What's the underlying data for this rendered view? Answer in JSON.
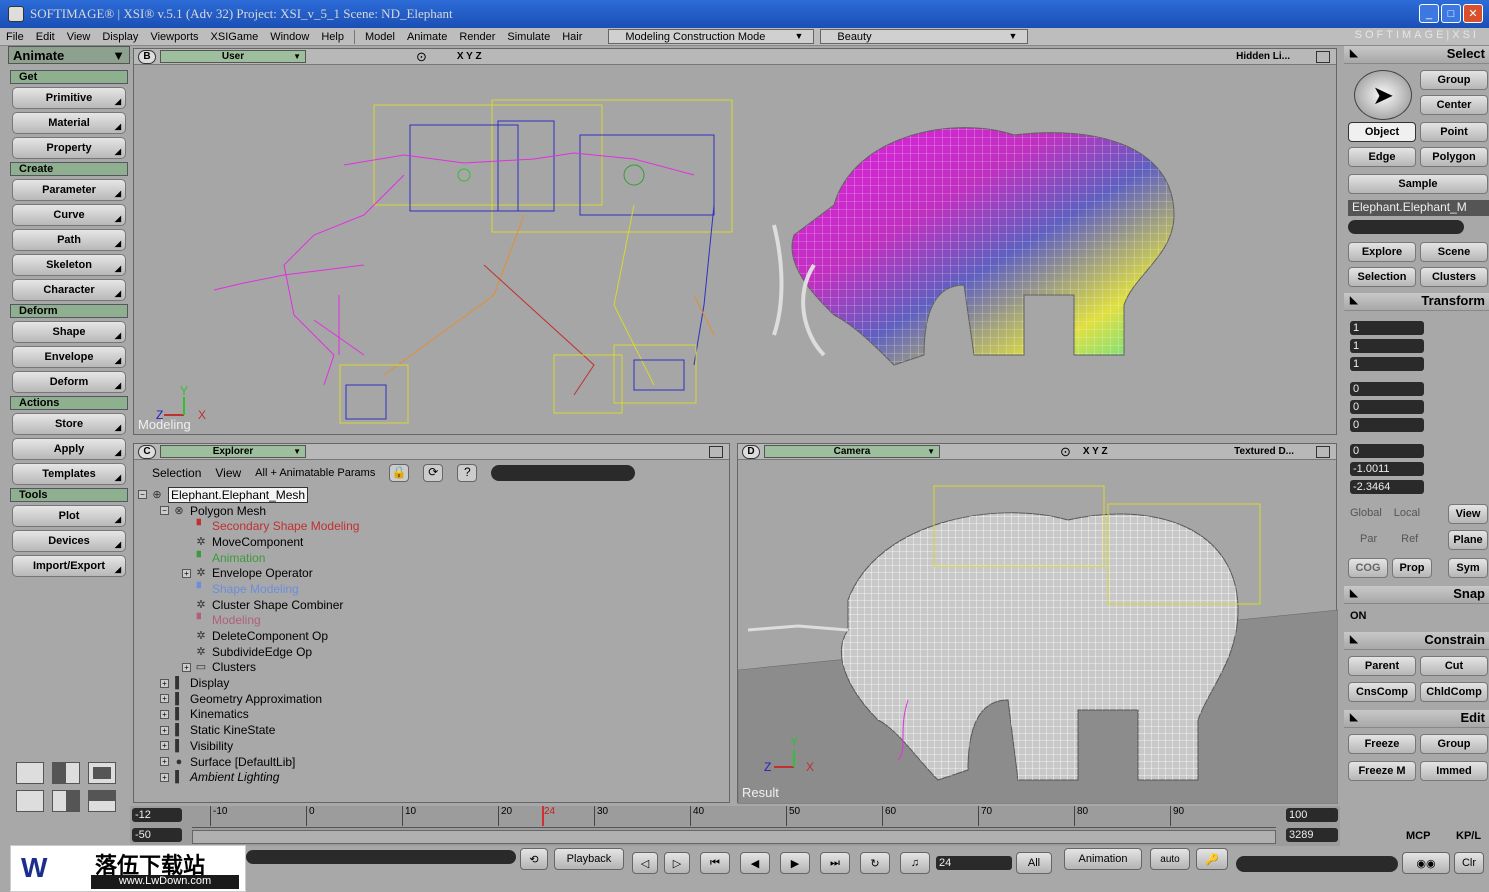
{
  "window": {
    "title": "SOFTIMAGE® | XSI® v.5.1 (Adv 32) Project: XSI_v_5_1     Scene: ND_Elephant",
    "brand": "SOFTIMAGE|XSI"
  },
  "menu": [
    "File",
    "Edit",
    "View",
    "Display",
    "Viewports",
    "XSIGame",
    "Window",
    "Help",
    "Model",
    "Animate",
    "Render",
    "Simulate",
    "Hair"
  ],
  "mode_dropdown": "Modeling Construction Mode",
  "pass_dropdown": "Beauty",
  "left_panel": {
    "mode": "Animate",
    "sections": [
      {
        "header": "Get",
        "buttons": [
          "Primitive",
          "Material",
          "Property"
        ]
      },
      {
        "header": "Create",
        "buttons": [
          "Parameter",
          "Curve",
          "Path",
          "Skeleton",
          "Character"
        ]
      },
      {
        "header": "Deform",
        "buttons": [
          "Shape",
          "Envelope",
          "Deform"
        ]
      },
      {
        "header": "Actions",
        "buttons": [
          "Store",
          "Apply",
          "Templates"
        ]
      },
      {
        "header": "Tools",
        "buttons": [
          "Plot",
          "Devices",
          "Import/Export"
        ]
      }
    ]
  },
  "viewport_b": {
    "letter": "B",
    "camera": "User",
    "axes": "X Y Z",
    "display": "Hidden Li...",
    "label": "Modeling"
  },
  "viewport_c": {
    "letter": "C",
    "camera": "Explorer",
    "toolbar": [
      "Selection",
      "View",
      "All + Animatable Params"
    ]
  },
  "viewport_d": {
    "letter": "D",
    "camera": "Camera",
    "axes": "X Y Z",
    "display": "Textured D...",
    "label": "Result"
  },
  "tree": [
    {
      "label": "Elephant.Elephant_Mesh",
      "level": 0,
      "exp": "⊟",
      "icon": "model",
      "color": "#000"
    },
    {
      "label": "Polygon Mesh",
      "level": 1,
      "exp": "⊟",
      "icon": "mesh",
      "color": "#000"
    },
    {
      "label": "Secondary Shape Modeling",
      "level": 2,
      "exp": "",
      "icon": "flag",
      "color": "#c03030"
    },
    {
      "label": "MoveComponent",
      "level": 2,
      "exp": "",
      "icon": "gear",
      "color": "#000"
    },
    {
      "label": "Animation",
      "level": 2,
      "exp": "",
      "icon": "flag",
      "color": "#3c9a3c"
    },
    {
      "label": "Envelope Operator",
      "level": 2,
      "exp": "⊞",
      "icon": "gear",
      "color": "#000"
    },
    {
      "label": "Shape Modeling",
      "level": 2,
      "exp": "",
      "icon": "flag",
      "color": "#6a8ee0"
    },
    {
      "label": "Cluster Shape Combiner",
      "level": 2,
      "exp": "",
      "icon": "gear",
      "color": "#000"
    },
    {
      "label": "Modeling",
      "level": 2,
      "exp": "",
      "icon": "flag",
      "color": "#b0607a"
    },
    {
      "label": "DeleteComponent Op",
      "level": 2,
      "exp": "",
      "icon": "gear",
      "color": "#000"
    },
    {
      "label": "SubdivideEdge Op",
      "level": 2,
      "exp": "",
      "icon": "gear",
      "color": "#000"
    },
    {
      "label": "Clusters",
      "level": 2,
      "exp": "⊞",
      "icon": "folder",
      "color": "#000"
    },
    {
      "label": "Display",
      "level": 1,
      "exp": "⊞",
      "icon": "prop",
      "color": "#000"
    },
    {
      "label": "Geometry Approximation",
      "level": 1,
      "exp": "⊞",
      "icon": "prop",
      "color": "#000"
    },
    {
      "label": "Kinematics",
      "level": 1,
      "exp": "⊞",
      "icon": "prop",
      "color": "#000"
    },
    {
      "label": "Static KineState",
      "level": 1,
      "exp": "⊞",
      "icon": "prop",
      "color": "#000"
    },
    {
      "label": "Visibility",
      "level": 1,
      "exp": "⊞",
      "icon": "prop",
      "color": "#000"
    },
    {
      "label": "Surface [DefaultLib]",
      "level": 1,
      "exp": "⊞",
      "icon": "sphere",
      "color": "#000"
    },
    {
      "label": "Ambient Lighting",
      "level": 1,
      "exp": "⊞",
      "icon": "prop",
      "color": "#000",
      "italic": true
    }
  ],
  "right_panel": {
    "select": "Select",
    "group": "Group",
    "center": "Center",
    "object": "Object",
    "point": "Point",
    "edge": "Edge",
    "polygon": "Polygon",
    "sample": "Sample",
    "selected_name": "Elephant.Elephant_M",
    "explore": "Explore",
    "scene": "Scene",
    "selection": "Selection",
    "clusters": "Clusters",
    "transform": "Transform",
    "scale": [
      "1",
      "1",
      "1"
    ],
    "rotation": [
      "0",
      "0",
      "0"
    ],
    "translation": [
      "0",
      "-1.0011",
      "-2.3464"
    ],
    "global": "Global",
    "local": "Local",
    "view": "View",
    "par": "Par",
    "ref": "Ref",
    "plane": "Plane",
    "cog": "COG",
    "prop": "Prop",
    "sym": "Sym",
    "snap": "Snap",
    "on": "ON",
    "constrain": "Constrain",
    "parent": "Parent",
    "cut": "Cut",
    "cnscomp": "CnsComp",
    "chldcomp": "ChldComp",
    "edit": "Edit",
    "freeze": "Freeze",
    "group2": "Group",
    "freezem": "Freeze M",
    "immed": "Immed",
    "mcp": "MCP",
    "kpl": "KP/L"
  },
  "timeline": {
    "start": "-12",
    "start2": "-50",
    "end": "100",
    "end2": "3289",
    "ticks": [
      "-10",
      "0",
      "10",
      "20",
      "30",
      "40",
      "50",
      "60",
      "70",
      "80",
      "90"
    ],
    "current": "24"
  },
  "playback": {
    "label": "Playback",
    "frame": "24",
    "all": "All",
    "animation": "Animation",
    "auto": "auto",
    "clr": "Clr"
  },
  "watermark": {
    "cn": "落伍下载站",
    "url": "www.LwDown.com"
  }
}
